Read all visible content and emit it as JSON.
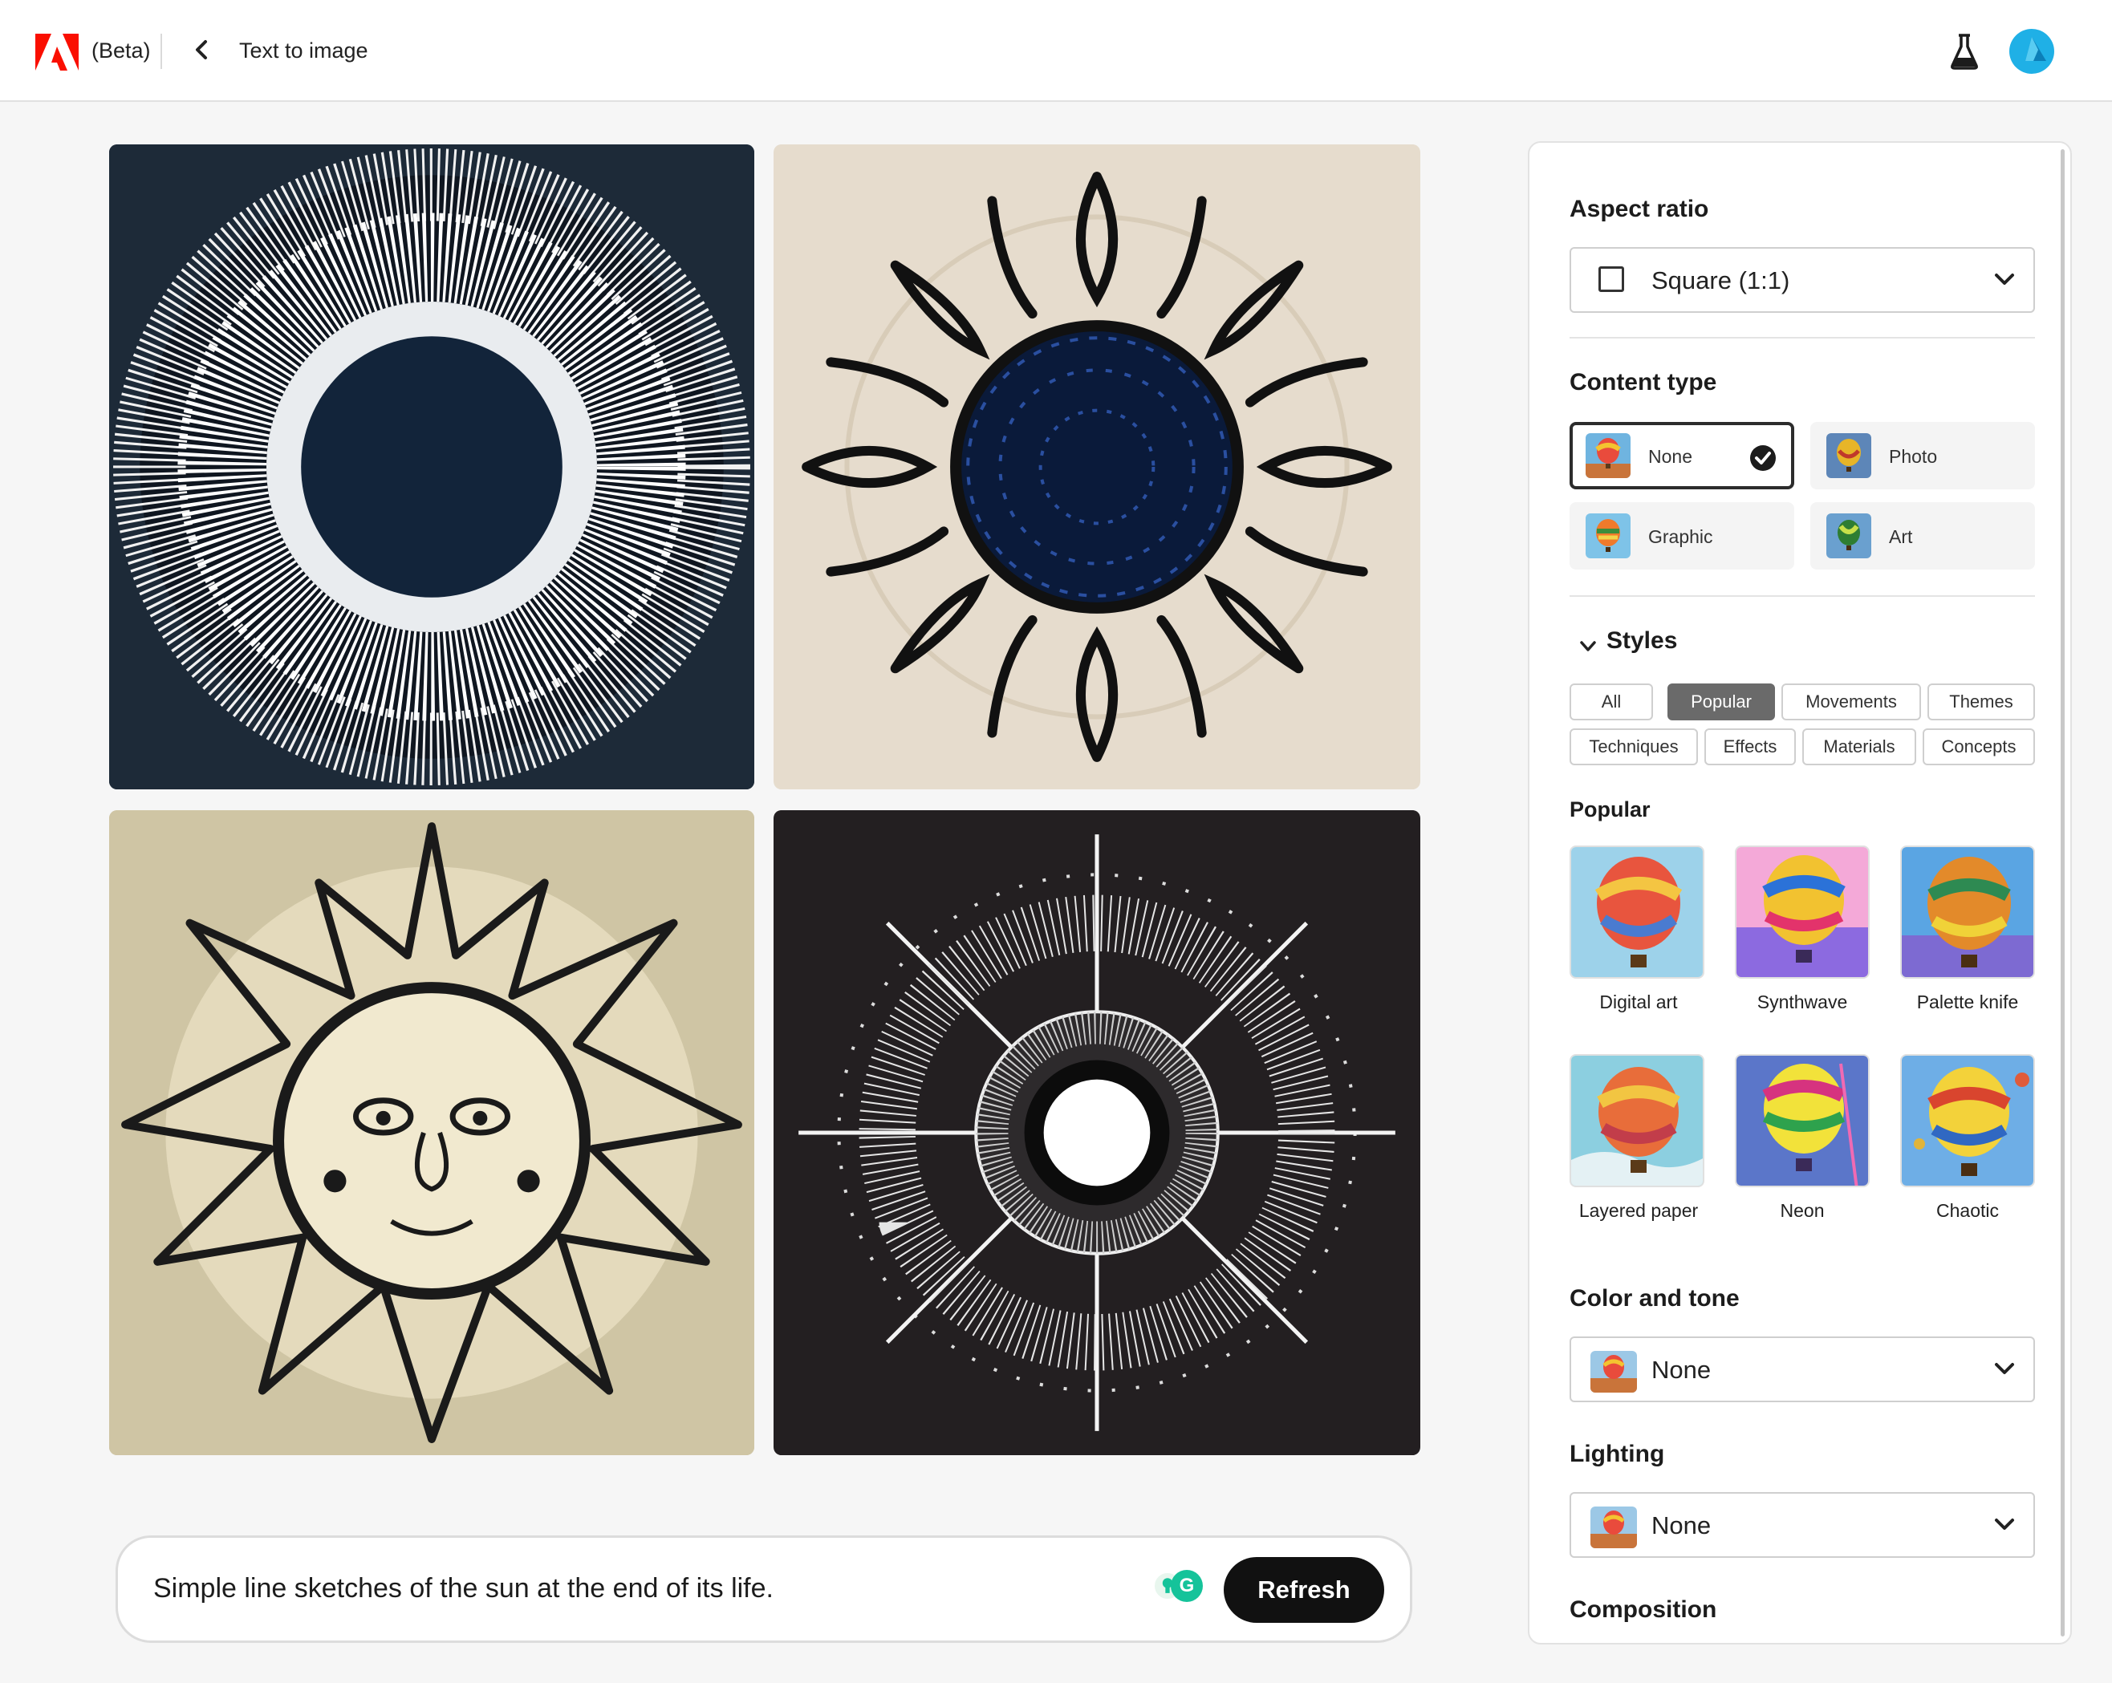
{
  "header": {
    "beta_label": "(Beta)",
    "breadcrumb": "Text to image",
    "icons": [
      "adobe-logo",
      "back-chevron-icon",
      "flask-icon",
      "avatar"
    ]
  },
  "prompt": {
    "text": "Simple line sketches of the sun at the end of its life.",
    "refresh_label": "Refresh",
    "grammarly_letter": "G"
  },
  "panel": {
    "aspect_ratio": {
      "title": "Aspect ratio",
      "value": "Square (1:1)"
    },
    "content_type": {
      "title": "Content type",
      "options": [
        {
          "label": "None",
          "selected": true
        },
        {
          "label": "Photo",
          "selected": false
        },
        {
          "label": "Graphic",
          "selected": false
        },
        {
          "label": "Art",
          "selected": false
        }
      ]
    },
    "styles": {
      "title": "Styles",
      "filters": [
        "All",
        "Popular",
        "Movements",
        "Themes",
        "Techniques",
        "Effects",
        "Materials",
        "Concepts"
      ],
      "active_filter": "Popular",
      "section_title": "Popular",
      "items": [
        {
          "label": "Digital art"
        },
        {
          "label": "Synthwave"
        },
        {
          "label": "Palette knife"
        },
        {
          "label": "Layered paper"
        },
        {
          "label": "Neon"
        },
        {
          "label": "Chaotic"
        }
      ]
    },
    "color_tone": {
      "title": "Color and tone",
      "value": "None"
    },
    "lighting": {
      "title": "Lighting",
      "value": "None"
    },
    "composition": {
      "title": "Composition"
    }
  },
  "colors": {
    "adobe_red": "#fa0f00",
    "avatar_blue": "#1fb0e6",
    "refresh_bg": "#111111",
    "active_pill": "#6a6a6a"
  }
}
